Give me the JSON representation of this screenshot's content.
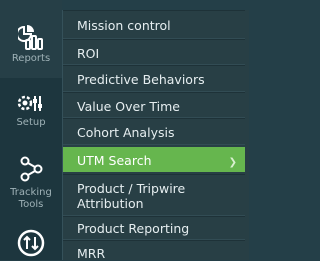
{
  "rail": {
    "items": [
      {
        "label": "Reports",
        "icon": "reports-icon",
        "active": true
      },
      {
        "label": "Setup",
        "icon": "setup-icon"
      },
      {
        "label": "Tracking Tools",
        "icon": "tracking-tools-icon"
      },
      {
        "label": "",
        "icon": "upgrade-icon"
      }
    ]
  },
  "submenu": {
    "items": [
      {
        "label": "Mission control"
      },
      {
        "label": "ROI"
      },
      {
        "label": "Predictive Behaviors"
      },
      {
        "label": "Value Over Time"
      },
      {
        "label": "Cohort Analysis"
      },
      {
        "label": "UTM Search",
        "active": true
      },
      {
        "label": "Product / Tripwire Attribution"
      },
      {
        "label": "Product Reporting"
      },
      {
        "label": "MRR"
      }
    ]
  },
  "colors": {
    "rail_bg": "#1d363e",
    "submenu_bg": "#283f45",
    "active_bg": "#66b64e",
    "text": "#e6eef0"
  }
}
